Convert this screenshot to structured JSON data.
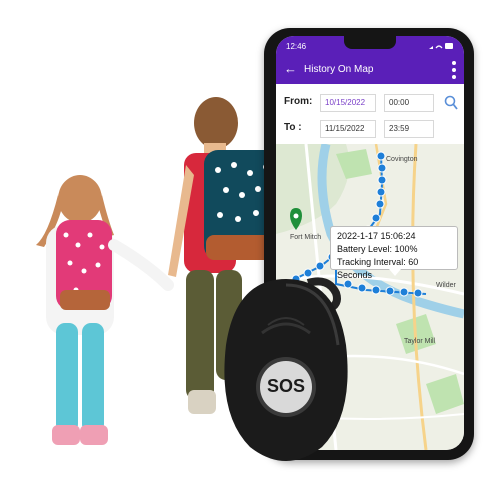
{
  "status_bar": {
    "time": "12:46"
  },
  "app_bar": {
    "title": "History On Map",
    "back_icon": "arrow-left-icon",
    "menu_icon": "more-vert-icon"
  },
  "form": {
    "from_label": "From:",
    "to_label": "To :",
    "from_date": "10/15/2022",
    "from_time": "00:00",
    "to_date": "11/15/2022",
    "to_time": "23:59",
    "search_icon": "search-icon"
  },
  "map": {
    "labels": {
      "covington": "Covington",
      "fort_mitchell": "Fort Mitch",
      "wilder": "Wilder",
      "taylor_mill": "Taylor Mill"
    },
    "tooltip": {
      "datetime": "2022-1-17 15:06:24",
      "battery": "Battery Level: 100%",
      "interval": "Tracking Interval: 60 Seconds"
    },
    "route_color": "#1e7fd8"
  },
  "tracker": {
    "button_label": "SOS"
  },
  "colors": {
    "brand": "#5a1fb8",
    "map_bg": "#eef0e6",
    "park": "#bfe3b0"
  }
}
